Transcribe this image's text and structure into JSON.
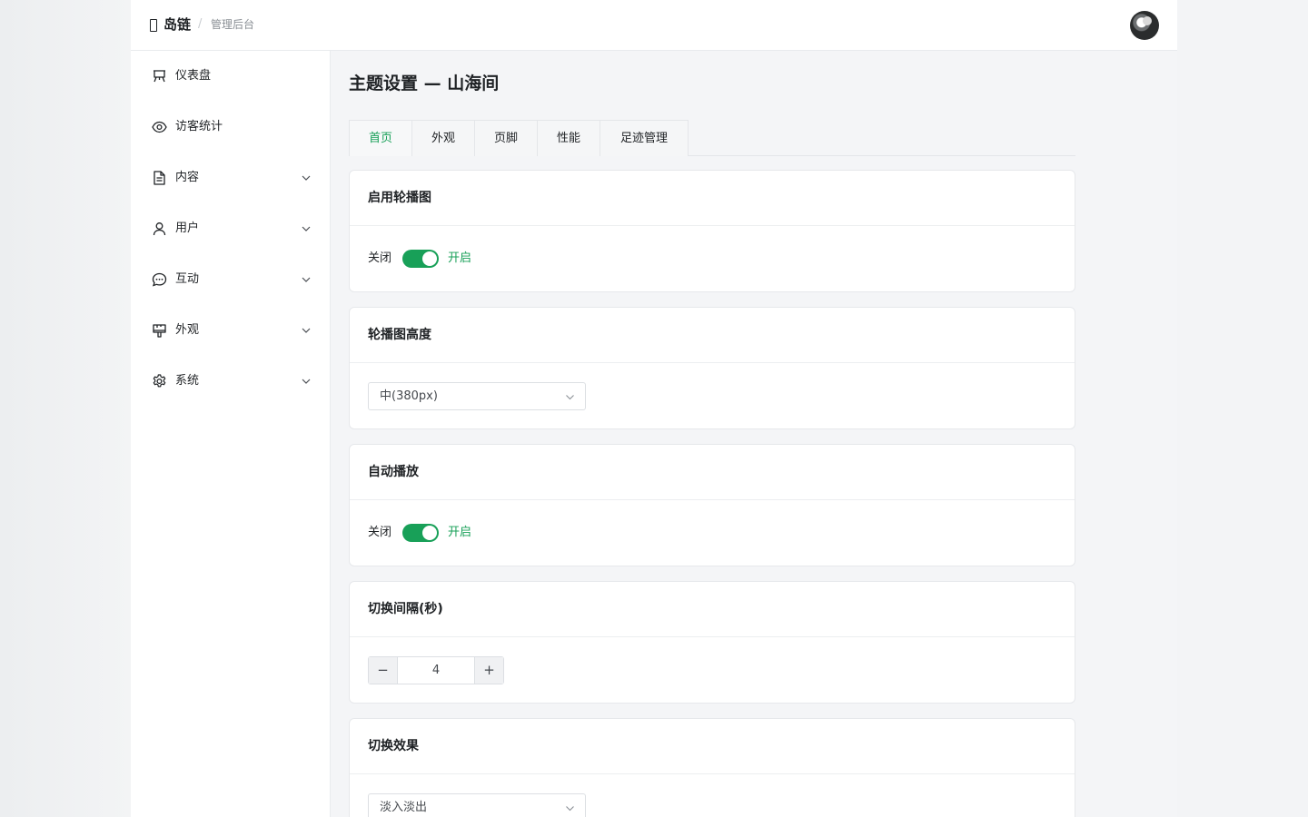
{
  "header": {
    "brand": "岛链",
    "separator": "/",
    "subtitle": "管理后台"
  },
  "sidebar": {
    "items": [
      {
        "label": "仪表盘",
        "icon": "dashboard-icon",
        "expandable": false
      },
      {
        "label": "访客统计",
        "icon": "eye-icon",
        "expandable": false
      },
      {
        "label": "内容",
        "icon": "document-icon",
        "expandable": true
      },
      {
        "label": "用户",
        "icon": "user-icon",
        "expandable": true
      },
      {
        "label": "互动",
        "icon": "chat-icon",
        "expandable": true
      },
      {
        "label": "外观",
        "icon": "brush-icon",
        "expandable": true
      },
      {
        "label": "系统",
        "icon": "gear-icon",
        "expandable": true
      }
    ]
  },
  "main": {
    "title": "主题设置 — 山海间",
    "tabs": [
      {
        "label": "首页",
        "active": true
      },
      {
        "label": "外观",
        "active": false
      },
      {
        "label": "页脚",
        "active": false
      },
      {
        "label": "性能",
        "active": false
      },
      {
        "label": "足迹管理",
        "active": false
      }
    ],
    "settings": {
      "carousel_enabled": {
        "title": "启用轮播图",
        "off_label": "关闭",
        "on_label": "开启",
        "value": true
      },
      "carousel_height": {
        "title": "轮播图高度",
        "value": "中(380px)"
      },
      "autoplay": {
        "title": "自动播放",
        "off_label": "关闭",
        "on_label": "开启",
        "value": true
      },
      "interval": {
        "title": "切换间隔(秒)",
        "value": "4",
        "minus": "−",
        "plus": "+"
      },
      "effect": {
        "title": "切换效果",
        "value": "淡入淡出"
      }
    }
  },
  "colors": {
    "accent": "#18a058",
    "background": "#f4f5f7",
    "card": "#ffffff",
    "border": "#e6e8eb"
  }
}
